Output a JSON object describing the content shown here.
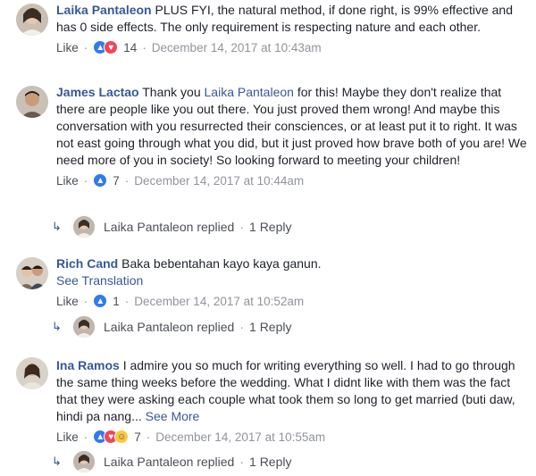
{
  "comments": [
    {
      "name": "Laika Pantaleon",
      "text": " PLUS FYI, the natural method, if done right, is 99% effective and has 0 side effects. The only requirement is respecting nature and each other.",
      "like_label": "Like",
      "reaction_count": "14",
      "timestamp": "December 14, 2017 at 10:43am"
    },
    {
      "name": "James Lactao",
      "text_before": " Thank you ",
      "mention": "Laika Pantaleon",
      "text_after": " for this! Maybe they don't realize that there are people like you out there. You just proved them wrong! And maybe this conversation with you resurrected their consciences, or at least put it to right. It was not east going through what you did, but it just proved how brave both of you are! We need more of you in society! So looking forward to meeting your children!",
      "like_label": "Like",
      "reaction_count": "7",
      "timestamp": "December 14, 2017 at 10:44am",
      "reply": {
        "name": "Laika Pantaleon",
        "replied": "replied",
        "count_label": "1 Reply"
      }
    },
    {
      "name": "Rich Cand",
      "text": " Baka bebentahan kayo kaya ganun.",
      "see_translation": "See Translation",
      "like_label": "Like",
      "reaction_count": "1",
      "timestamp": "December 14, 2017 at 10:52am",
      "reply": {
        "name": "Laika Pantaleon",
        "replied": "replied",
        "count_label": "1 Reply"
      }
    },
    {
      "name": "Ina Ramos",
      "text": " I admire you so much for writing everything so well. I had to go through the same thing weeks before the wedding. What I didnt like with them was the fact that they were asking each couple what took them so long to get married (buti daw, hindi pa nang...",
      "see_more": "See More",
      "like_label": "Like",
      "reaction_count": "7",
      "timestamp": "December 14, 2017 at 10:55am",
      "reply": {
        "name": "Laika Pantaleon",
        "replied": "replied",
        "count_label": "1 Reply"
      }
    }
  ],
  "separator": "·",
  "colors": {
    "link": "#365899",
    "text": "#1d2129",
    "meta": "#90949c",
    "like_reaction": "#2f7bf0",
    "love_reaction": "#f0465a",
    "haha_reaction": "#f7c944"
  }
}
